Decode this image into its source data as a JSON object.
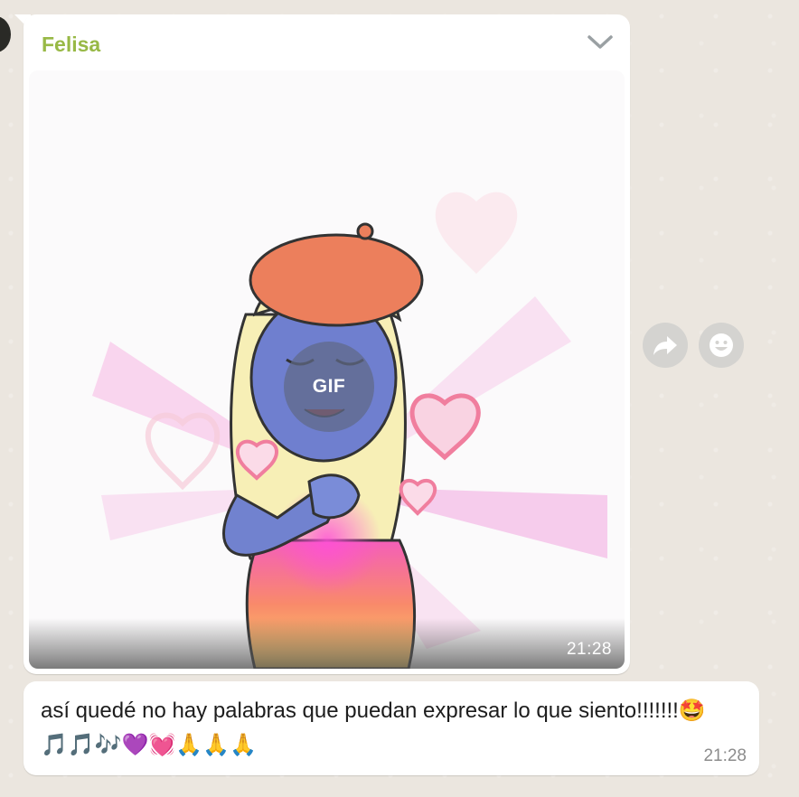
{
  "chat": {
    "sender_name": "Felisa",
    "gif_message": {
      "badge_label": "GIF",
      "time": "21:28"
    },
    "text_message": {
      "text": "así quedé no hay palabras que puedan expresar lo que siento!!!!!!!🤩🎵🎵🎶💜💓🙏🙏🙏",
      "time": "21:28"
    }
  },
  "icons": {
    "menu": "chevron-down-icon",
    "forward": "forward-arrow-icon",
    "react": "smiley-icon"
  },
  "colors": {
    "sender_name": "#98b946",
    "bubble": "#ffffff",
    "wallpaper": "#ebe6df",
    "action_button": "#d4d3d0"
  }
}
